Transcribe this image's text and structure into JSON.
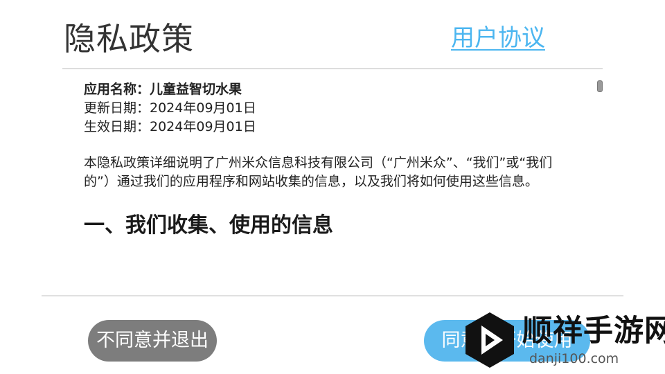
{
  "header": {
    "title": "隐私政策",
    "agreement_link": "用户协议"
  },
  "policy": {
    "app_name": "应用名称：儿童益智切水果",
    "updated": "更新日期：2024年09月01日",
    "effective": "生效日期：2024年09月01日",
    "intro": "本隐私政策详细说明了广州米众信息科技有限公司（“广州米众”、“我们”或“我们的”）通过我们的应用程序和网站收集的信息，以及我们将如何使用这些信息。",
    "section_heading": "一、我们收集、使用的信息"
  },
  "buttons": {
    "decline_label": "不同意并退出",
    "accept_label": "同意并开始使用"
  },
  "watermark": {
    "site_name": "顺祥手游网",
    "domain": "danji100.com"
  },
  "colors": {
    "link": "#4cb6f0",
    "accept_button": "#5bb9ee",
    "decline_button": "#7d7d7d"
  }
}
